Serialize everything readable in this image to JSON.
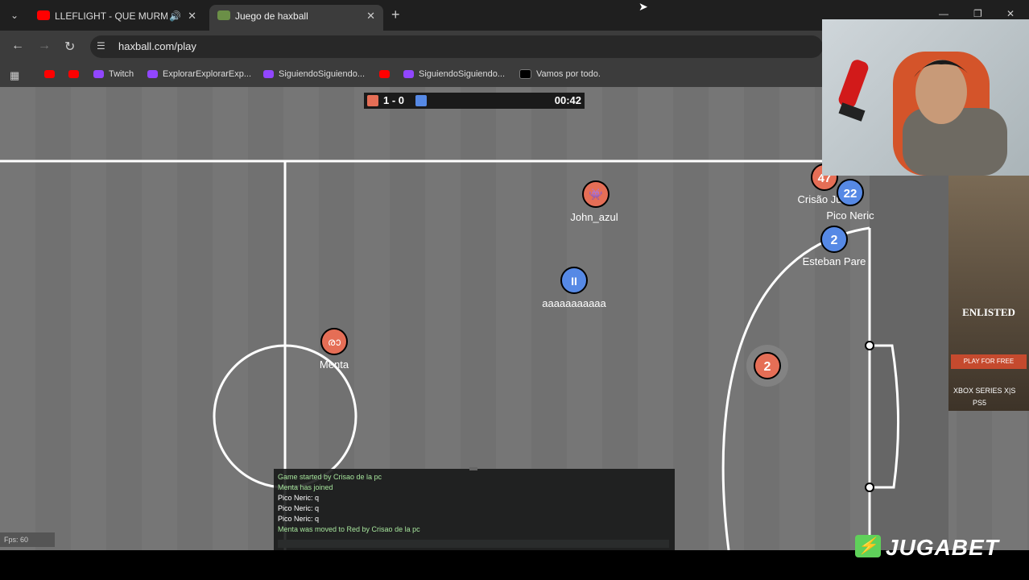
{
  "browser": {
    "tabs": [
      {
        "label": "LLEFLIGHT - QUE MURMUR",
        "favicon_color": "#ff0000",
        "active": false,
        "audio_icon": "speaker-icon"
      },
      {
        "label": "Juego de haxball",
        "favicon_color": "#6b8f47",
        "active": true
      }
    ],
    "url": "haxball.com/play",
    "bookmarks": [
      {
        "label": "",
        "icon_color": "#ff0000"
      },
      {
        "label": "",
        "icon_color": "#ff0000"
      },
      {
        "label": "Twitch",
        "icon_color": "#9146ff"
      },
      {
        "label": "ExplorarExplorarExp...",
        "icon_color": "#9146ff"
      },
      {
        "label": "SiguiendoSiguiendo...",
        "icon_color": "#9146ff"
      },
      {
        "label": "",
        "icon_color": "#ff0000"
      },
      {
        "label": "SiguiendoSiguiendo...",
        "icon_color": "#9146ff"
      },
      {
        "label": "Vamos por todo.",
        "icon_color": "#000000"
      }
    ]
  },
  "scoreboard": {
    "score": "1 - 0",
    "time": "00:42",
    "red_color": "#e56e56",
    "blue_color": "#5689e5"
  },
  "players": [
    {
      "name": "John_azul",
      "avatar": "👾",
      "team": "red"
    },
    {
      "name": "aaaaaaaaaaa",
      "avatar": "II",
      "team": "blue"
    },
    {
      "name": "Menta",
      "avatar": "രാ",
      "team": "red"
    },
    {
      "name": "",
      "avatar": "2",
      "team": "red"
    },
    {
      "name": "Esteban Pare",
      "avatar": "2",
      "team": "blue"
    },
    {
      "name": "Pico Neric",
      "avatar": "22",
      "team": "blue"
    },
    {
      "name": "Crisão Ju",
      "avatar": "47",
      "team": "red"
    }
  ],
  "chat": {
    "lines": [
      {
        "text": "Game started by Crisao de la pc",
        "kind": "system"
      },
      {
        "text": "Menta has joined",
        "kind": "system"
      },
      {
        "text": "Pico Neric: q",
        "kind": "message"
      },
      {
        "text": "Pico Neric: q",
        "kind": "message"
      },
      {
        "text": "Pico Neric: q",
        "kind": "message"
      },
      {
        "text": "Menta was moved to Red by Crisao de la pc",
        "kind": "system"
      }
    ]
  },
  "fps": "Fps: 60",
  "ad": {
    "title": "ENLISTED",
    "button": "PLAY FOR FREE",
    "platforms": [
      "XBOX SERIES X|S",
      "PS5"
    ]
  },
  "sponsor_logo": "JUGABET"
}
